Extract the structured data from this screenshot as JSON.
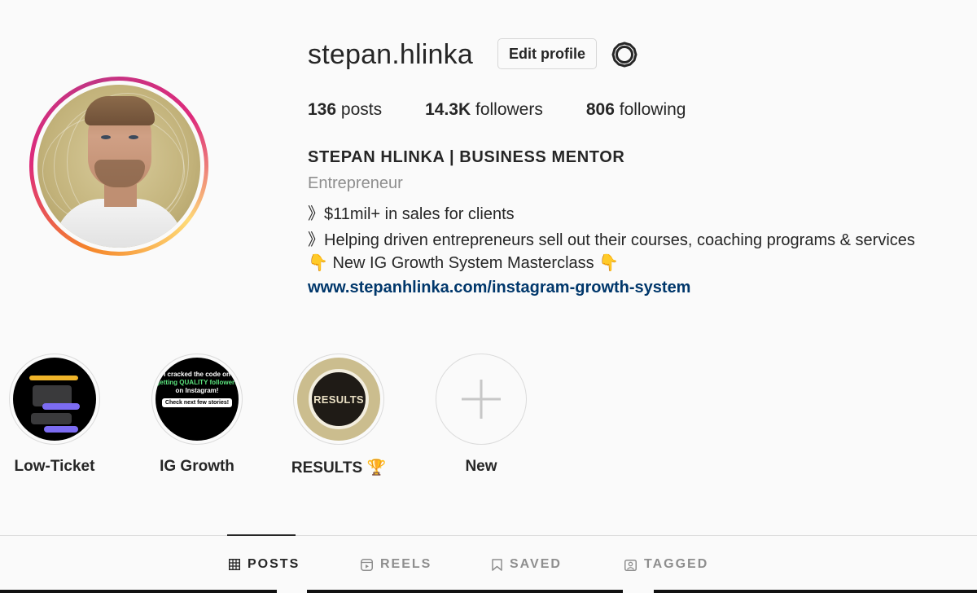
{
  "profile": {
    "username": "stepan.hlinka",
    "edit_label": "Edit profile",
    "settings_icon": "gear-icon",
    "stats": {
      "posts_count": "136",
      "posts_label": "posts",
      "followers_count": "14.3K",
      "followers_label": "followers",
      "following_count": "806",
      "following_label": "following"
    },
    "full_name": "STEPAN HLINKA | BUSINESS MENTOR",
    "category": "Entrepreneur",
    "bio": [
      "》$11mil+ in sales for clients",
      "》Helping driven entrepreneurs sell out their courses, coaching programs & services",
      "👇 New IG Growth System Masterclass 👇"
    ],
    "link": "www.stepanhlinka.com/instagram-growth-system"
  },
  "highlights": [
    {
      "label": "Low-Ticket"
    },
    {
      "label": "IG Growth",
      "cover_text_1": "I cracked the code on",
      "cover_text_2": "getting QUALITY followers",
      "cover_text_3": "on Instagram!",
      "cover_text_4": "Check next few stories!"
    },
    {
      "label": "RESULTS 🏆",
      "cover_text": "RESULTS"
    },
    {
      "label": "New"
    }
  ],
  "tabs": [
    {
      "label": "POSTS",
      "icon": "grid-icon",
      "active": true
    },
    {
      "label": "REELS",
      "icon": "reels-icon",
      "active": false
    },
    {
      "label": "SAVED",
      "icon": "bookmark-icon",
      "active": false
    },
    {
      "label": "TAGGED",
      "icon": "tagged-icon",
      "active": false
    }
  ],
  "colors": {
    "link": "#00376b",
    "muted": "#8e8e8e",
    "text": "#262626"
  }
}
